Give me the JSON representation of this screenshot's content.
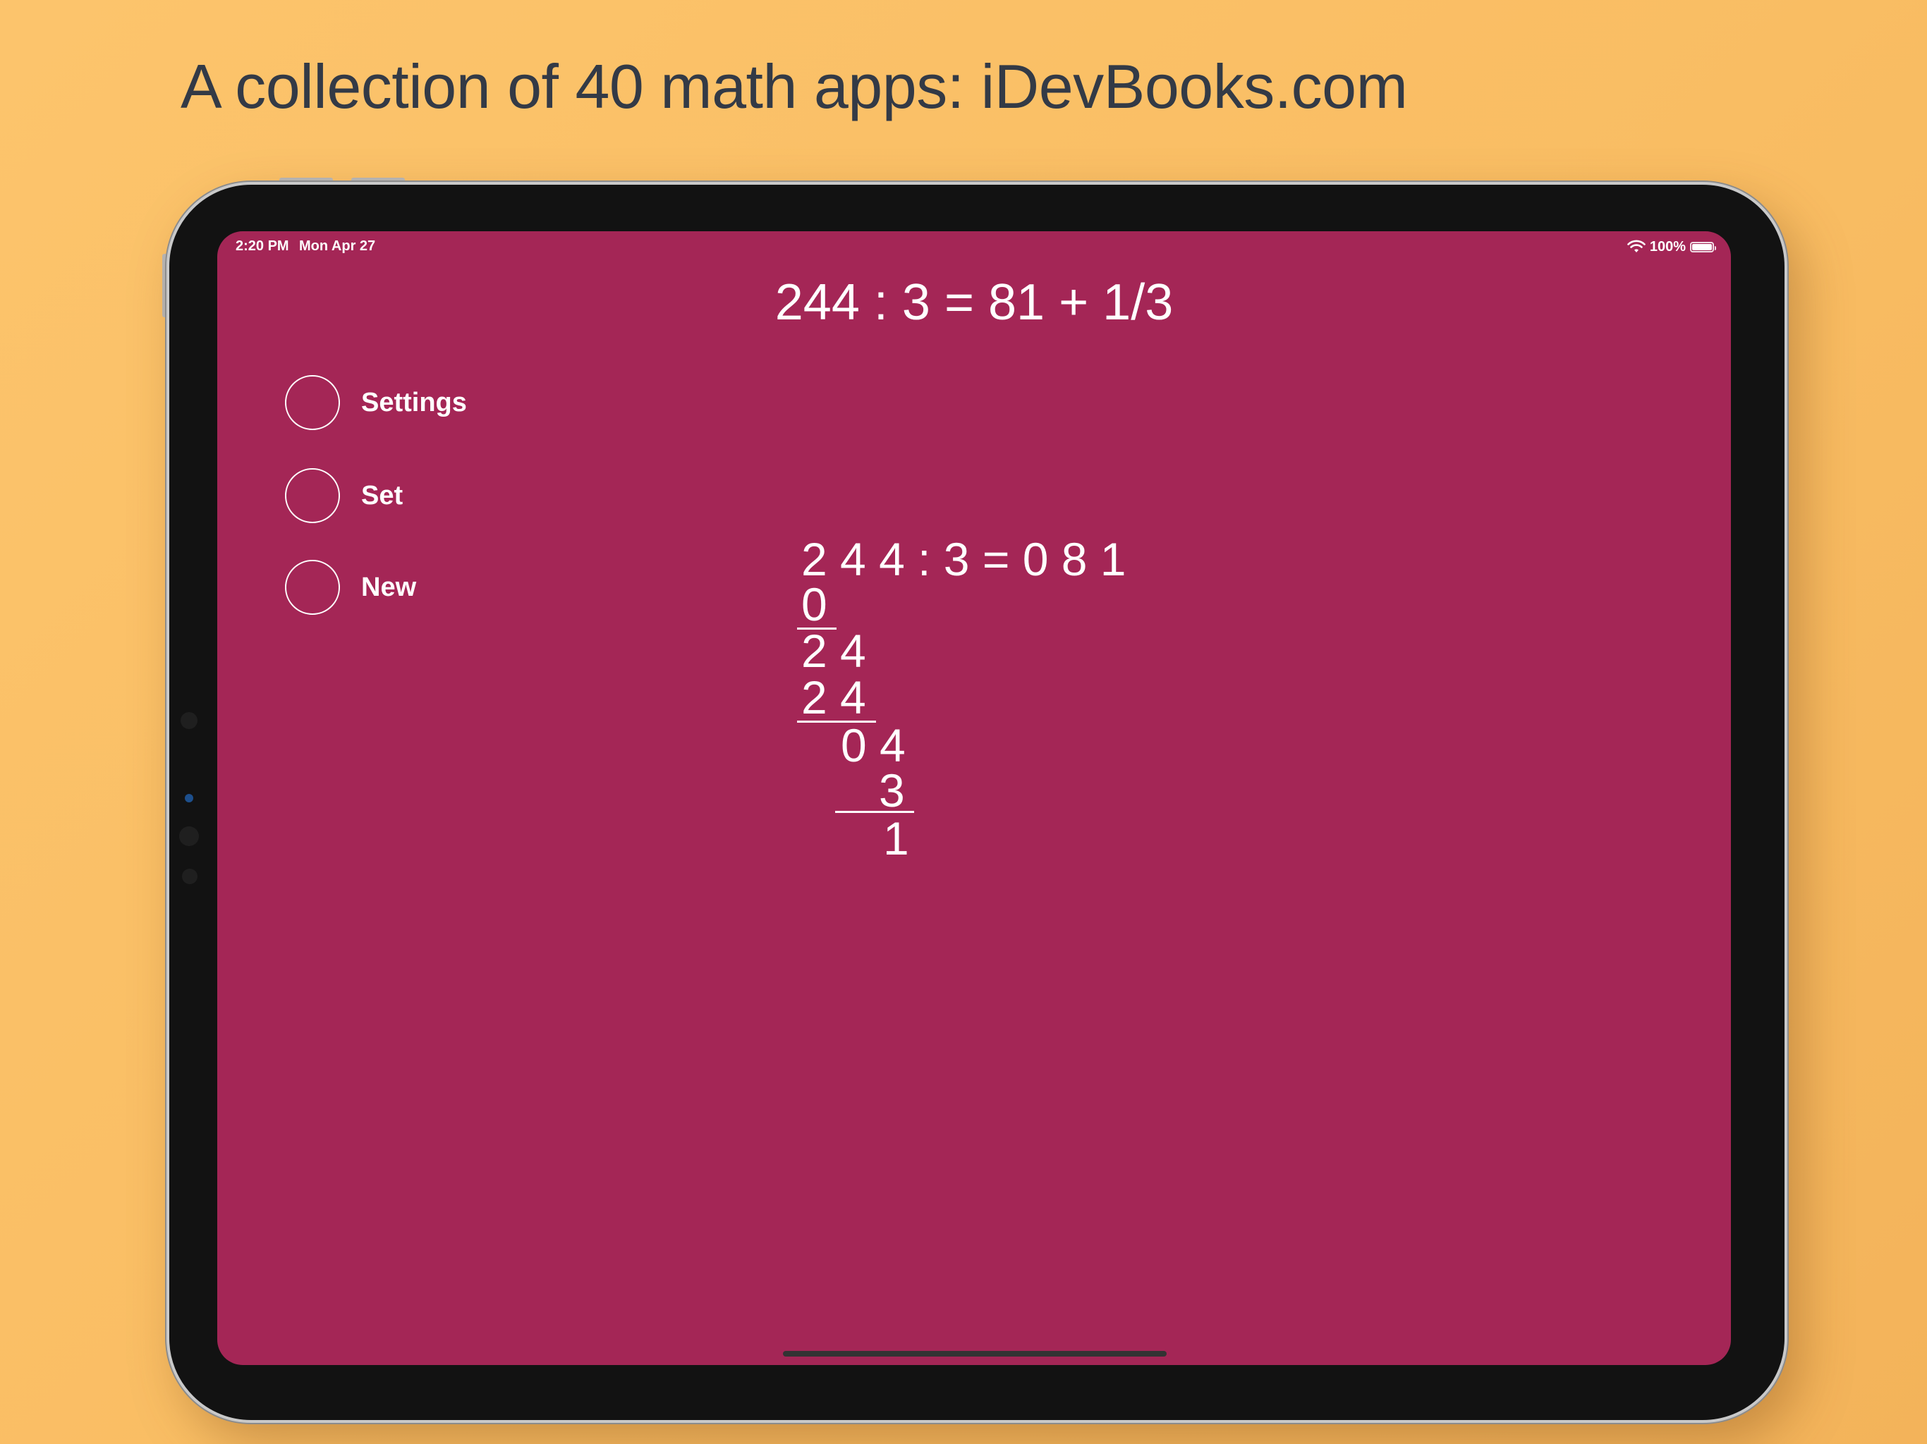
{
  "headline": "A collection of 40 math apps: iDevBooks.com",
  "status_bar": {
    "time": "2:20 PM",
    "date": "Mon Apr 27",
    "battery": "100%"
  },
  "equation": "244 : 3 = 81 + 1/3",
  "menu": {
    "settings": "Settings",
    "set": "Set",
    "new": "New"
  },
  "long_division": {
    "header": "2 4 4 : 3 = 0 8 1",
    "rows": [
      "0",
      "2 4",
      "2 4",
      "0 4",
      "3",
      "1"
    ]
  },
  "colors": {
    "background": "#fcc46c",
    "screen": "#a42656",
    "headline": "#333a46",
    "bezel": "#121212"
  }
}
